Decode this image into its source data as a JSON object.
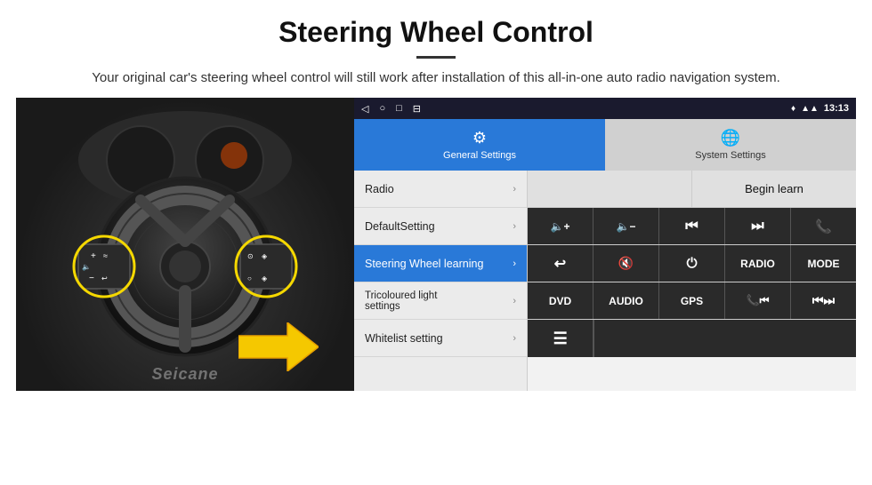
{
  "header": {
    "title": "Steering Wheel Control",
    "subtitle": "Your original car's steering wheel control will still work after installation of this all-in-one auto radio navigation system."
  },
  "status_bar": {
    "time": "13:13",
    "nav_icons": [
      "◁",
      "○",
      "□",
      "⊟"
    ],
    "signal_icons": [
      "♦",
      "▲",
      "📶"
    ]
  },
  "tabs": [
    {
      "label": "General Settings",
      "active": true
    },
    {
      "label": "System Settings",
      "active": false
    }
  ],
  "menu_items": [
    {
      "label": "Radio",
      "active": false
    },
    {
      "label": "DefaultSetting",
      "active": false
    },
    {
      "label": "Steering Wheel learning",
      "active": true
    },
    {
      "label": "Tricoloured light settings",
      "active": false
    },
    {
      "label": "Whitelist setting",
      "active": false
    }
  ],
  "panel": {
    "begin_learn_label": "Begin learn",
    "control_rows": [
      [
        {
          "label": "🔈+",
          "type": "icon"
        },
        {
          "label": "🔈-",
          "type": "icon"
        },
        {
          "label": "⏮",
          "type": "icon"
        },
        {
          "label": "⏭",
          "type": "icon"
        },
        {
          "label": "📞",
          "type": "icon"
        }
      ],
      [
        {
          "label": "↩",
          "type": "icon"
        },
        {
          "label": "🔇",
          "type": "icon"
        },
        {
          "label": "⏻",
          "type": "icon"
        },
        {
          "label": "RADIO",
          "type": "text"
        },
        {
          "label": "MODE",
          "type": "text"
        }
      ],
      [
        {
          "label": "DVD",
          "type": "text"
        },
        {
          "label": "AUDIO",
          "type": "text"
        },
        {
          "label": "GPS",
          "type": "text"
        },
        {
          "label": "📞⏮",
          "type": "icon"
        },
        {
          "label": "⏮⏭",
          "type": "icon"
        }
      ],
      [
        {
          "label": "≡",
          "type": "icon"
        }
      ]
    ]
  },
  "watermark": "Seicane"
}
